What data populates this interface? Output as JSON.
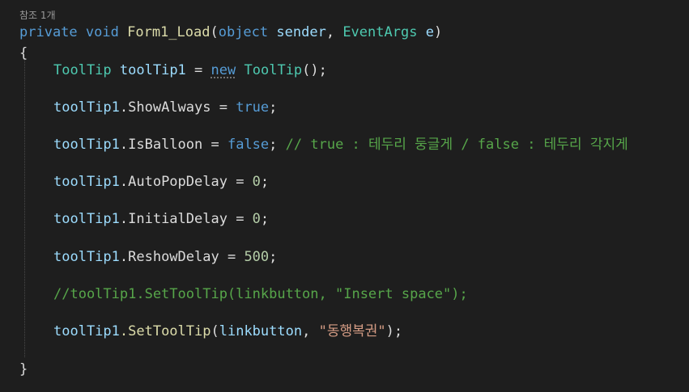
{
  "codelens": "참조 1개",
  "signature": {
    "kw_private": "private",
    "kw_void": "void",
    "method_name": "Form1_Load",
    "open_paren": "(",
    "kw_object": "object",
    "param_sender": "sender",
    "comma": ",",
    "type_eventargs": "EventArgs",
    "param_e": "e",
    "close_paren": ")"
  },
  "brace_open": "{",
  "brace_close": "}",
  "line_decl": {
    "type": "ToolTip",
    "var": "toolTip1",
    "eq": "=",
    "kw_new": "new",
    "ctor": "ToolTip",
    "rest": "();"
  },
  "line_show_always": {
    "obj": "toolTip1",
    "prop": ".ShowAlways",
    "eq": " = ",
    "value": "true",
    "end": ";"
  },
  "line_is_balloon": {
    "obj": "toolTip1",
    "prop": ".IsBalloon",
    "eq": " = ",
    "value": "false",
    "end": ";",
    "comment": "// true : 테두리 둥글게 / false : 테두리 각지게"
  },
  "line_auto_pop": {
    "obj": "toolTip1",
    "prop": ".AutoPopDelay",
    "eq": " = ",
    "value": "0",
    "end": ";"
  },
  "line_initial": {
    "obj": "toolTip1",
    "prop": ".InitialDelay",
    "eq": " = ",
    "value": "0",
    "end": ";"
  },
  "line_reshow": {
    "obj": "toolTip1",
    "prop": ".ReshowDelay",
    "eq": " = ",
    "value": "500",
    "end": ";"
  },
  "line_commented": "//toolTip1.SetToolTip(linkbutton, \"Insert space\");",
  "line_set_tooltip": {
    "obj": "toolTip1",
    "method": ".SetToolTip",
    "open": "(",
    "arg": "linkbutton",
    "comma": ", ",
    "str": "\"동행복권\"",
    "close": ");"
  }
}
